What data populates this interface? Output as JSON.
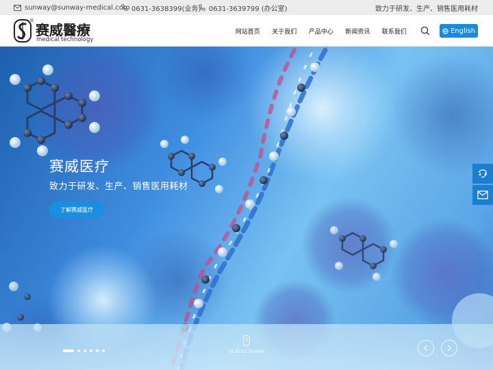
{
  "topbar": {
    "email": "sunway@sunway-medical.com",
    "phone_business": "0631-3638399(业务)",
    "phone_office": "0631-3639799 (办公室)",
    "slogan": "致力于研发、生产、销售医用耗材"
  },
  "header": {
    "logo_cn": "赛威醫療",
    "logo_en": "medical technology",
    "logo_reg": "®",
    "nav": [
      "网站首页",
      "关于我们",
      "产品中心",
      "新闻资讯",
      "联系我们"
    ],
    "lang_label": "English"
  },
  "hero": {
    "title": "赛威医疗",
    "subtitle": "致力于研发、生产、销售医用耗材",
    "button_label": "了解赛威医疗",
    "scroll_label": "SCROLL DOWN",
    "slide_count": 6,
    "active_slide": 0
  },
  "icons": {
    "email": "mail-icon",
    "phone": "phone-icon",
    "search": "search-icon",
    "globe": "globe-icon",
    "prev": "chevron-left-icon",
    "next": "chevron-right-icon",
    "chat": "chat-icon",
    "message": "envelope-icon"
  },
  "colors": {
    "accent": "#1b8ad8",
    "side_tool": "#1b7fd0",
    "topbar_bg": "#ececec"
  }
}
